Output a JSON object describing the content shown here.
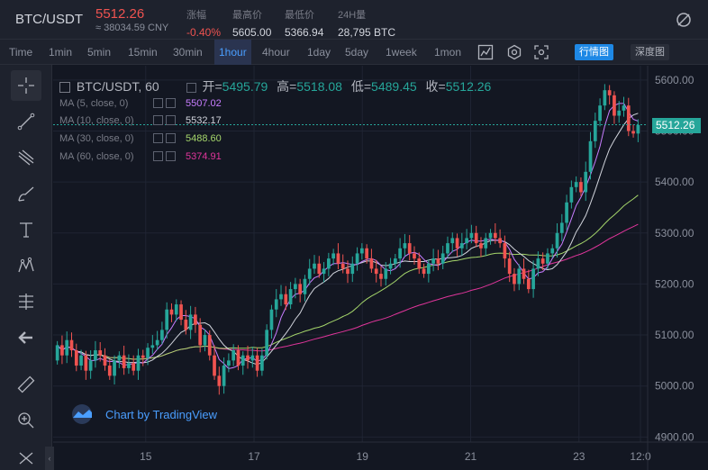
{
  "ticker": {
    "pair": "BTC/USDT",
    "last_price": "5512.26",
    "cny_price": "≈ 38034.59 CNY",
    "change_label": "涨幅",
    "change_value": "-0.40%",
    "high_label": "最高价",
    "high_value": "5605.00",
    "low_label": "最低价",
    "low_value": "5366.94",
    "volume_label": "24H量",
    "volume_value": "28,795 BTC"
  },
  "toolbar": {
    "timeframes": [
      "Time",
      "1min",
      "5min",
      "15min",
      "30min",
      "1hour",
      "4hour",
      "1day",
      "5day",
      "1week",
      "1mon"
    ],
    "active_timeframe": "1hour",
    "kline_label": "行情图",
    "depth_label": "深度图"
  },
  "legend": {
    "symbol": "BTC/USDT, 60",
    "open_label": "开=",
    "open": "5495.79",
    "high_label": "高=",
    "high": "5518.08",
    "low_label": "低=",
    "low": "5489.45",
    "close_label": "收=",
    "close": "5512.26",
    "ma": [
      {
        "label": "MA (5, close, 0)",
        "value": "5507.02",
        "color": "#c77dff"
      },
      {
        "label": "MA (10, close, 0)",
        "value": "5532.17",
        "color": "#d1d4dc"
      },
      {
        "label": "MA (30, close, 0)",
        "value": "5488.60",
        "color": "#a5d66b"
      },
      {
        "label": "MA (60, close, 0)",
        "value": "5374.91",
        "color": "#e0359b"
      }
    ]
  },
  "watermark": "Chart by TradingView",
  "chart_data": {
    "type": "candlestick",
    "x_ticks": [
      "15",
      "17",
      "19",
      "21",
      "23",
      "12:0"
    ],
    "y_ticks": [
      5600,
      5500,
      5400,
      5300,
      5200,
      5100,
      5000,
      4900
    ],
    "ylim": [
      4890,
      5628
    ],
    "last_price_label": "5512.26",
    "colors": {
      "up": "#26a69a",
      "down": "#ef5350",
      "ma5": "#c77dff",
      "ma10": "#d1d4dc",
      "ma30": "#a5d66b",
      "ma60": "#e0359b"
    },
    "candles": [
      [
        5050,
        5080
      ],
      [
        5080,
        5060
      ],
      [
        5060,
        5090
      ],
      [
        5090,
        5070
      ],
      [
        5070,
        5040
      ],
      [
        5040,
        5060
      ],
      [
        5060,
        5030
      ],
      [
        5030,
        5050
      ],
      [
        5050,
        5070
      ],
      [
        5070,
        5060
      ],
      [
        5060,
        5040
      ],
      [
        5040,
        5020
      ],
      [
        5020,
        5050
      ],
      [
        5050,
        5060
      ],
      [
        5060,
        5035
      ],
      [
        5035,
        5045
      ],
      [
        5045,
        5030
      ],
      [
        5030,
        5060
      ],
      [
        5060,
        5055
      ],
      [
        5055,
        5075
      ],
      [
        5075,
        5080
      ],
      [
        5080,
        5090
      ],
      [
        5090,
        5110
      ],
      [
        5110,
        5150
      ],
      [
        5150,
        5140
      ],
      [
        5140,
        5160
      ],
      [
        5160,
        5130
      ],
      [
        5130,
        5110
      ],
      [
        5110,
        5140
      ],
      [
        5140,
        5120
      ],
      [
        5120,
        5080
      ],
      [
        5080,
        5100
      ],
      [
        5100,
        5060
      ],
      [
        5060,
        5020
      ],
      [
        5020,
        5000
      ],
      [
        5000,
        5040
      ],
      [
        5040,
        5050
      ],
      [
        5050,
        5070
      ],
      [
        5070,
        5040
      ],
      [
        5040,
        5060
      ],
      [
        5060,
        5050
      ],
      [
        5050,
        5060
      ],
      [
        5060,
        5030
      ],
      [
        5030,
        5060
      ],
      [
        5060,
        5110
      ],
      [
        5110,
        5150
      ],
      [
        5150,
        5170
      ],
      [
        5170,
        5180
      ],
      [
        5180,
        5160
      ],
      [
        5160,
        5190
      ],
      [
        5190,
        5200
      ],
      [
        5200,
        5180
      ],
      [
        5180,
        5210
      ],
      [
        5210,
        5230
      ],
      [
        5230,
        5240
      ],
      [
        5240,
        5220
      ],
      [
        5220,
        5230
      ],
      [
        5230,
        5250
      ],
      [
        5250,
        5260
      ],
      [
        5260,
        5240
      ],
      [
        5240,
        5230
      ],
      [
        5230,
        5220
      ],
      [
        5220,
        5240
      ],
      [
        5240,
        5260
      ],
      [
        5260,
        5270
      ],
      [
        5270,
        5250
      ],
      [
        5250,
        5230
      ],
      [
        5230,
        5220
      ],
      [
        5220,
        5210
      ],
      [
        5210,
        5230
      ],
      [
        5230,
        5240
      ],
      [
        5240,
        5250
      ],
      [
        5250,
        5270
      ],
      [
        5270,
        5280
      ],
      [
        5280,
        5260
      ],
      [
        5260,
        5250
      ],
      [
        5250,
        5230
      ],
      [
        5230,
        5220
      ],
      [
        5220,
        5240
      ],
      [
        5240,
        5250
      ],
      [
        5250,
        5240
      ],
      [
        5240,
        5260
      ],
      [
        5260,
        5280
      ],
      [
        5280,
        5290
      ],
      [
        5290,
        5270
      ],
      [
        5270,
        5280
      ],
      [
        5280,
        5290
      ],
      [
        5290,
        5300
      ],
      [
        5300,
        5280
      ],
      [
        5280,
        5270
      ],
      [
        5270,
        5290
      ],
      [
        5290,
        5300
      ],
      [
        5300,
        5290
      ],
      [
        5290,
        5280
      ],
      [
        5280,
        5250
      ],
      [
        5250,
        5220
      ],
      [
        5220,
        5200
      ],
      [
        5200,
        5230
      ],
      [
        5230,
        5210
      ],
      [
        5210,
        5190
      ],
      [
        5190,
        5230
      ],
      [
        5230,
        5250
      ],
      [
        5250,
        5240
      ],
      [
        5240,
        5260
      ],
      [
        5260,
        5270
      ],
      [
        5270,
        5300
      ],
      [
        5300,
        5320
      ],
      [
        5320,
        5360
      ],
      [
        5360,
        5390
      ],
      [
        5390,
        5400
      ],
      [
        5400,
        5380
      ],
      [
        5380,
        5420
      ],
      [
        5420,
        5480
      ],
      [
        5480,
        5520
      ],
      [
        5520,
        5550
      ],
      [
        5550,
        5580
      ],
      [
        5580,
        5570
      ],
      [
        5570,
        5530
      ],
      [
        5530,
        5540
      ],
      [
        5540,
        5550
      ],
      [
        5550,
        5500
      ],
      [
        5500,
        5495
      ],
      [
        5495,
        5512
      ]
    ]
  }
}
